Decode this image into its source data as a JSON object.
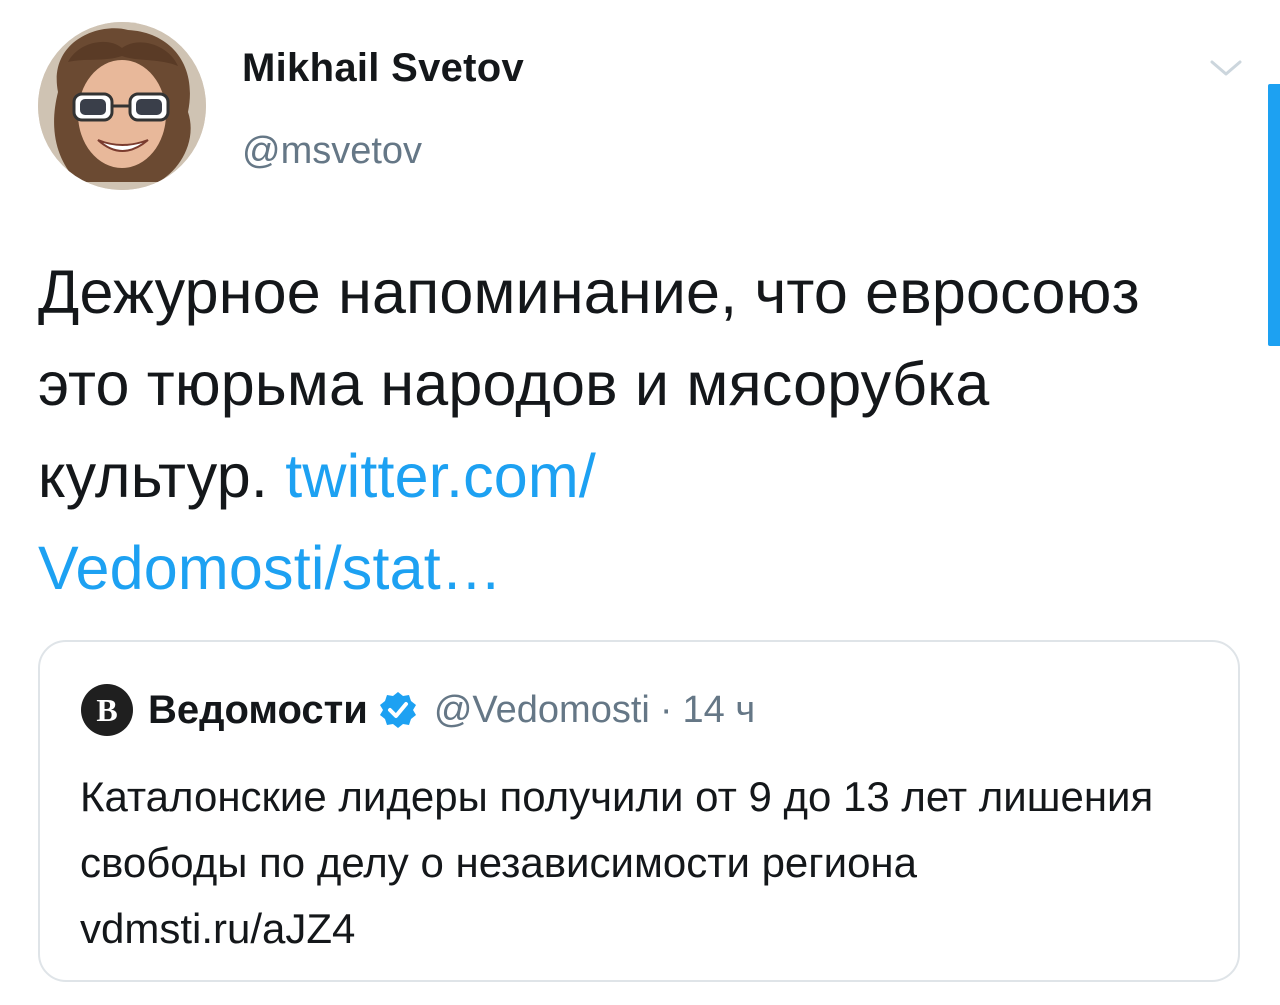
{
  "author": {
    "display_name": "Mikhail Svetov",
    "handle": "@msvetov"
  },
  "tweet": {
    "text": "Дежурное напоминание, что евросоюз это тюрьма народов и мясорубка культур.",
    "link_line1": "twitter.com/",
    "link_line2": "Vedomosti/stat…"
  },
  "quoted": {
    "display_name": "Ведомости",
    "handle": "@Vedomosti",
    "separator": "·",
    "time": "14 ч",
    "text": "Каталонские лидеры получили от 9 до 13 лет лишения свободы по делу о независимости региона vdmsti.ru/aJZ4"
  },
  "colors": {
    "link": "#1da1f2",
    "text": "#14171a",
    "secondary": "#657786",
    "card_border": "#dfe4e8"
  },
  "icons": {
    "menu": "chevron-down-icon",
    "verified": "verified-badge-icon",
    "quoted_logo": "vedomosti-logo-icon"
  }
}
